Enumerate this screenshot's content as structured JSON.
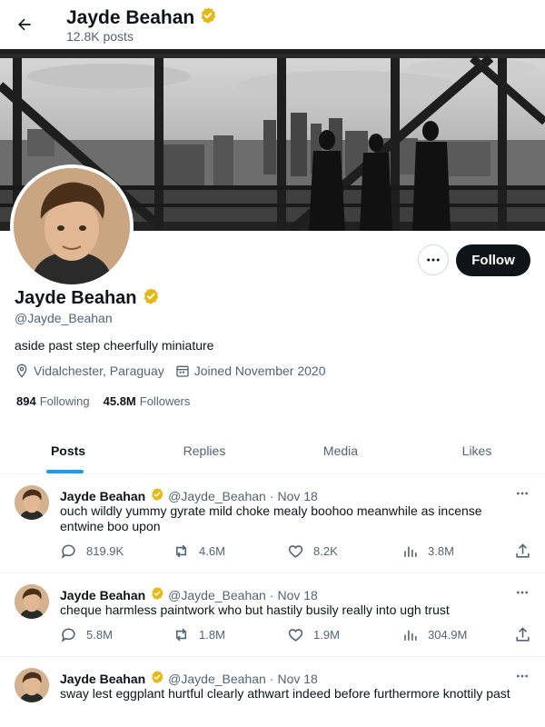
{
  "header": {
    "name": "Jayde Beahan",
    "posts_count": "12.8K posts"
  },
  "profile": {
    "name": "Jayde Beahan",
    "handle": "@Jayde_Beahan",
    "bio": "aside past step cheerfully miniature",
    "location": "Vidalchester, Paraguay",
    "joined": "Joined November 2020",
    "following_count": "894",
    "following_label": "Following",
    "followers_count": "45.8M",
    "followers_label": "Followers",
    "follow_label": "Follow"
  },
  "tabs": [
    {
      "label": "Posts",
      "active": true
    },
    {
      "label": "Replies",
      "active": false
    },
    {
      "label": "Media",
      "active": false
    },
    {
      "label": "Likes",
      "active": false
    }
  ],
  "tweets": [
    {
      "name": "Jayde Beahan",
      "handle": "@Jayde_Beahan",
      "date": "Nov 18",
      "text": "ouch wildly yummy gyrate mild choke mealy boohoo meanwhile as incense entwine boo upon",
      "replies": "819.9K",
      "reposts": "4.6M",
      "likes": "8.2K",
      "views": "3.8M"
    },
    {
      "name": "Jayde Beahan",
      "handle": "@Jayde_Beahan",
      "date": "Nov 18",
      "text": "cheque harmless paintwork who but hastily busily really into ugh trust",
      "replies": "5.8M",
      "reposts": "1.8M",
      "likes": "1.9M",
      "views": "304.9M"
    },
    {
      "name": "Jayde Beahan",
      "handle": "@Jayde_Beahan",
      "date": "Nov 18",
      "text": "sway lest eggplant hurtful clearly athwart indeed before furthermore knottily past"
    }
  ],
  "colors": {
    "accent": "#1d9bf0",
    "verified": "#e5b815",
    "text_primary": "#0f1419",
    "text_secondary": "#536471"
  },
  "icons": {
    "back": "arrow-left-icon",
    "verified": "verified-badge-icon",
    "more": "more-icon",
    "location": "location-icon",
    "calendar": "calendar-icon",
    "reply": "reply-icon",
    "repost": "repost-icon",
    "like": "like-icon",
    "views": "views-icon",
    "share": "share-icon"
  }
}
